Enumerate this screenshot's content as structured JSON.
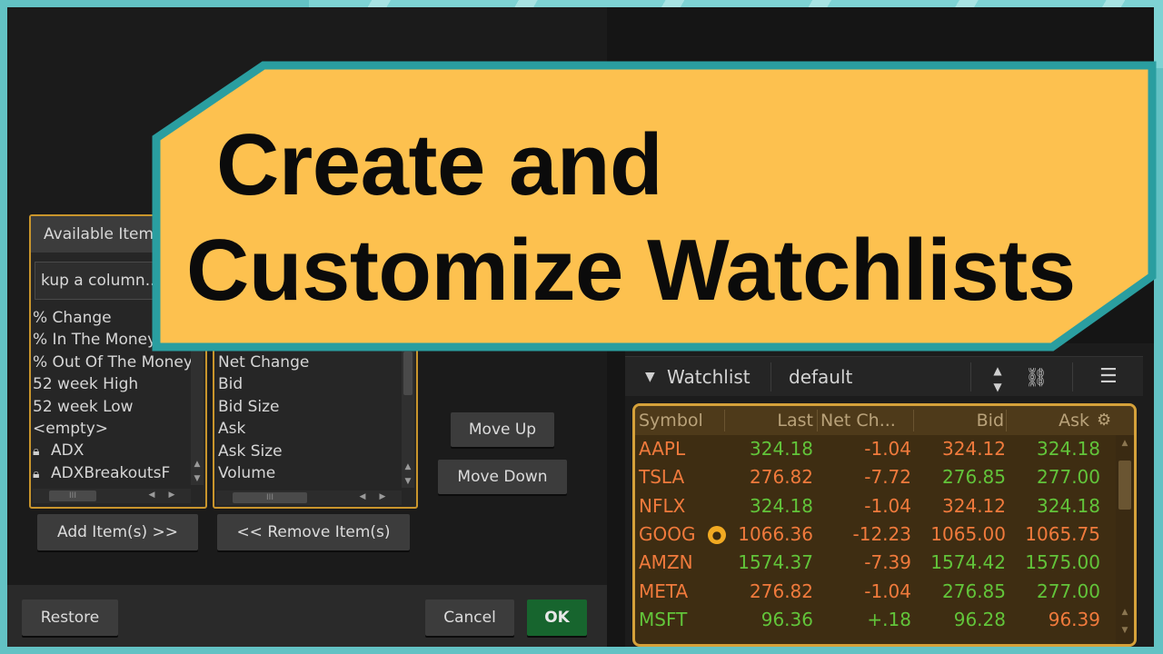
{
  "banner": {
    "line1": "Create and",
    "line2": "Customize Watchlists",
    "fill_color": "#fdc14f",
    "border_color": "#2a9ea0"
  },
  "dialog": {
    "available": {
      "header": "Available Items",
      "lookup_text": "kup a column...",
      "items": [
        {
          "label": "% Change",
          "lock": false
        },
        {
          "label": "% In The Money",
          "lock": false
        },
        {
          "label": "% Out Of The Money",
          "lock": false
        },
        {
          "label": "52 week High",
          "lock": false
        },
        {
          "label": "52 week Low",
          "lock": false
        },
        {
          "label": "<empty>",
          "lock": false
        },
        {
          "label": "ADX",
          "lock": true
        },
        {
          "label": "ADXBreakoutsF",
          "lock": true
        }
      ]
    },
    "current": {
      "items": [
        "Net Change",
        "Bid",
        "Bid Size",
        "Ask",
        "Ask Size",
        "Volume"
      ]
    },
    "buttons": {
      "move_up": "Move Up",
      "move_down": "Move Down",
      "add": "Add Item(s) >>",
      "remove": "<< Remove Item(s)",
      "restore": "Restore",
      "cancel": "Cancel",
      "ok": "OK"
    }
  },
  "watchlist": {
    "title": "Watchlist",
    "name": "default",
    "columns": [
      "Symbol",
      "Last",
      "Net Ch...",
      "Bid",
      "Ask"
    ],
    "rows": [
      {
        "symbol": "AAPL",
        "last": "324.18",
        "chg": "-1.04",
        "bid": "324.12",
        "ask": "324.18",
        "sym_c": "#f07a3c",
        "last_c": "#62c43a",
        "chg_c": "#f07a3c",
        "bid_c": "#f07a3c",
        "ask_c": "#62c43a"
      },
      {
        "symbol": "TSLA",
        "last": "276.82",
        "chg": "-7.72",
        "bid": "276.85",
        "ask": "277.00",
        "sym_c": "#f07a3c",
        "last_c": "#f07a3c",
        "chg_c": "#f07a3c",
        "bid_c": "#62c43a",
        "ask_c": "#62c43a"
      },
      {
        "symbol": "NFLX",
        "last": "324.18",
        "chg": "-1.04",
        "bid": "324.12",
        "ask": "324.18",
        "sym_c": "#f07a3c",
        "last_c": "#62c43a",
        "chg_c": "#f07a3c",
        "bid_c": "#f07a3c",
        "ask_c": "#62c43a"
      },
      {
        "symbol": "GOOG",
        "last": "1066.36",
        "chg": "-12.23",
        "bid": "1065.00",
        "ask": "1065.75",
        "sym_c": "#f07a3c",
        "last_c": "#f07a3c",
        "chg_c": "#f07a3c",
        "bid_c": "#f07a3c",
        "ask_c": "#f07a3c",
        "icon": true
      },
      {
        "symbol": "AMZN",
        "last": "1574.37",
        "chg": "-7.39",
        "bid": "1574.42",
        "ask": "1575.00",
        "sym_c": "#f07a3c",
        "last_c": "#62c43a",
        "chg_c": "#f07a3c",
        "bid_c": "#62c43a",
        "ask_c": "#62c43a"
      },
      {
        "symbol": "META",
        "last": "276.82",
        "chg": "-1.04",
        "bid": "276.85",
        "ask": "277.00",
        "sym_c": "#f07a3c",
        "last_c": "#f07a3c",
        "chg_c": "#f07a3c",
        "bid_c": "#62c43a",
        "ask_c": "#62c43a"
      },
      {
        "symbol": "MSFT",
        "last": "96.36",
        "chg": "+.18",
        "bid": "96.28",
        "ask": "96.39",
        "sym_c": "#62c43a",
        "last_c": "#62c43a",
        "chg_c": "#62c43a",
        "bid_c": "#62c43a",
        "ask_c": "#f07a3c"
      }
    ]
  },
  "icons": {
    "lock": "lock-icon",
    "chevron": "chevron-down-icon",
    "spinner": "spinner-icon",
    "link": "link-icon",
    "menu": "menu-icon",
    "gear": "gear-icon",
    "info": "person-info-icon"
  }
}
